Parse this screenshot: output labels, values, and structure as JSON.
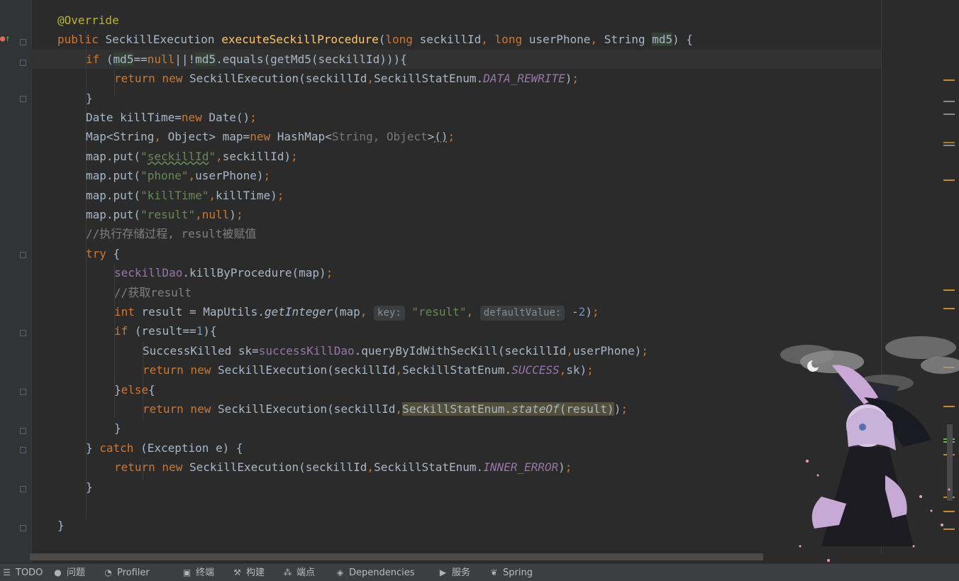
{
  "editor": {
    "lines": [
      {
        "tokens": [
          {
            "c": "ann",
            "t": "@Override"
          }
        ]
      },
      {
        "tokens": [
          {
            "c": "kw",
            "t": "public "
          },
          {
            "c": "",
            "t": "SeckillExecution "
          },
          {
            "c": "fn",
            "t": "executeSeckillProcedure"
          },
          {
            "c": "",
            "t": "("
          },
          {
            "c": "kw",
            "t": "long "
          },
          {
            "c": "",
            "t": "seckillId"
          },
          {
            "c": "kw",
            "t": ", long "
          },
          {
            "c": "",
            "t": "userPhone"
          },
          {
            "c": "kw",
            "t": ", "
          },
          {
            "c": "",
            "t": "String "
          },
          {
            "c": "p-md5",
            "t": "md5"
          },
          {
            "c": "",
            "t": ") {"
          }
        ]
      },
      {
        "tokens": [
          {
            "c": "kw",
            "t": "if "
          },
          {
            "c": "",
            "t": "("
          },
          {
            "c": "p-md5",
            "t": "md5"
          },
          {
            "c": "",
            "t": "=="
          },
          {
            "c": "kw",
            "t": "null"
          },
          {
            "c": "",
            "t": "||!"
          },
          {
            "c": "caret",
            "t": ""
          },
          {
            "c": "p-md5",
            "t": "md5"
          },
          {
            "c": "",
            "t": ".equals(getMd5(seckillId))){"
          }
        ]
      },
      {
        "tokens": [
          {
            "c": "kw",
            "t": "return new "
          },
          {
            "c": "",
            "t": "SeckillExecution(seckillId"
          },
          {
            "c": "kw",
            "t": ","
          },
          {
            "c": "",
            "t": "SeckillStatEnum."
          },
          {
            "c": "cst",
            "t": "DATA_REWRITE"
          },
          {
            "c": "",
            "t": ")"
          },
          {
            "c": "kw",
            "t": ";"
          }
        ]
      },
      {
        "tokens": [
          {
            "c": "",
            "t": "}"
          }
        ]
      },
      {
        "tokens": [
          {
            "c": "",
            "t": "Date killTime="
          },
          {
            "c": "kw",
            "t": "new "
          },
          {
            "c": "",
            "t": "Date()"
          },
          {
            "c": "kw",
            "t": ";"
          }
        ]
      },
      {
        "tokens": [
          {
            "c": "",
            "t": "Map<String"
          },
          {
            "c": "kw",
            "t": ", "
          },
          {
            "c": "",
            "t": "Object> map="
          },
          {
            "c": "kw",
            "t": "new "
          },
          {
            "c": "",
            "t": "HashMap<"
          },
          {
            "c": "gr",
            "t": "String, Object"
          },
          {
            "c": "",
            "t": ">"
          },
          {
            "c": "dotu",
            "t": "()"
          },
          {
            "c": "kw",
            "t": ";"
          }
        ]
      },
      {
        "tokens": [
          {
            "c": "",
            "t": "map.put("
          },
          {
            "c": "str",
            "t": "\""
          },
          {
            "c": "str uline",
            "t": "seckillId"
          },
          {
            "c": "str",
            "t": "\""
          },
          {
            "c": "kw",
            "t": ","
          },
          {
            "c": "",
            "t": "seckillId)"
          },
          {
            "c": "kw",
            "t": ";"
          }
        ]
      },
      {
        "tokens": [
          {
            "c": "",
            "t": "map.put("
          },
          {
            "c": "str",
            "t": "\"phone\""
          },
          {
            "c": "kw",
            "t": ","
          },
          {
            "c": "",
            "t": "userPhone)"
          },
          {
            "c": "kw",
            "t": ";"
          }
        ]
      },
      {
        "tokens": [
          {
            "c": "",
            "t": "map.put("
          },
          {
            "c": "str",
            "t": "\"killTime\""
          },
          {
            "c": "kw",
            "t": ","
          },
          {
            "c": "",
            "t": "killTime)"
          },
          {
            "c": "kw",
            "t": ";"
          }
        ]
      },
      {
        "tokens": [
          {
            "c": "",
            "t": "map.put("
          },
          {
            "c": "str",
            "t": "\"result\""
          },
          {
            "c": "kw",
            "t": ",null"
          },
          {
            "c": "",
            "t": ")"
          },
          {
            "c": "kw",
            "t": ";"
          }
        ]
      },
      {
        "tokens": [
          {
            "c": "cmt",
            "t": "//执行存储过程, result被赋值"
          }
        ]
      },
      {
        "tokens": [
          {
            "c": "kw",
            "t": "try "
          },
          {
            "c": "",
            "t": "{"
          }
        ]
      },
      {
        "tokens": [
          {
            "c": "fld",
            "t": "seckillDao"
          },
          {
            "c": "",
            "t": ".killByProcedure(map)"
          },
          {
            "c": "kw",
            "t": ";"
          }
        ]
      },
      {
        "tokens": [
          {
            "c": "cmt",
            "t": "//获取result"
          }
        ]
      },
      {
        "tokens": [
          {
            "c": "kw",
            "t": "int "
          },
          {
            "c": "",
            "t": "result = MapUtils."
          },
          {
            "c": "st",
            "t": "getInteger"
          },
          {
            "c": "",
            "t": "(map"
          },
          {
            "c": "kw",
            "t": ", "
          },
          {
            "c": "hint",
            "t": "key:"
          },
          {
            "c": "str",
            "t": " \"result\""
          },
          {
            "c": "kw",
            "t": ", "
          },
          {
            "c": "hint",
            "t": "defaultValue:"
          },
          {
            "c": "",
            "t": " -"
          },
          {
            "c": "num",
            "t": "2"
          },
          {
            "c": "",
            "t": ")"
          },
          {
            "c": "kw",
            "t": ";"
          }
        ]
      },
      {
        "tokens": [
          {
            "c": "kw",
            "t": "if "
          },
          {
            "c": "",
            "t": "(result=="
          },
          {
            "c": "num",
            "t": "1"
          },
          {
            "c": "",
            "t": "){"
          }
        ]
      },
      {
        "tokens": [
          {
            "c": "",
            "t": "SuccessKilled sk="
          },
          {
            "c": "fld",
            "t": "successKillDao"
          },
          {
            "c": "",
            "t": ".queryByIdWithSecKill(seckillId"
          },
          {
            "c": "kw",
            "t": ","
          },
          {
            "c": "",
            "t": "userPhone)"
          },
          {
            "c": "kw",
            "t": ";"
          }
        ]
      },
      {
        "tokens": [
          {
            "c": "kw",
            "t": "return new "
          },
          {
            "c": "",
            "t": "SeckillExecution(seckillId"
          },
          {
            "c": "kw",
            "t": ","
          },
          {
            "c": "",
            "t": "SeckillStatEnum."
          },
          {
            "c": "cst",
            "t": "SUCCESS"
          },
          {
            "c": "kw",
            "t": ","
          },
          {
            "c": "",
            "t": "sk)"
          },
          {
            "c": "kw",
            "t": ";"
          }
        ]
      },
      {
        "tokens": [
          {
            "c": "",
            "t": "}"
          },
          {
            "c": "kw",
            "t": "else"
          },
          {
            "c": "",
            "t": "{"
          }
        ]
      },
      {
        "tokens": [
          {
            "c": "kw",
            "t": "return new "
          },
          {
            "c": "",
            "t": "SeckillExecution(seckillId"
          },
          {
            "c": "kw",
            "t": ","
          },
          {
            "c": "sel",
            "t": "SeckillStatEnum."
          },
          {
            "c": "sel st",
            "t": "stateOf"
          },
          {
            "c": "sel",
            "t": "(result)"
          },
          {
            "c": "",
            "t": ")"
          },
          {
            "c": "kw",
            "t": ";"
          }
        ]
      },
      {
        "tokens": [
          {
            "c": "",
            "t": "}"
          }
        ]
      },
      {
        "tokens": [
          {
            "c": "",
            "t": "} "
          },
          {
            "c": "kw",
            "t": "catch "
          },
          {
            "c": "",
            "t": "(Exception e) {"
          }
        ]
      },
      {
        "tokens": [
          {
            "c": "kw",
            "t": "return new "
          },
          {
            "c": "",
            "t": "SeckillExecution(seckillId"
          },
          {
            "c": "kw",
            "t": ","
          },
          {
            "c": "",
            "t": "SeckillStatEnum."
          },
          {
            "c": "cst",
            "t": "INNER_ERROR"
          },
          {
            "c": "",
            "t": ")"
          },
          {
            "c": "kw",
            "t": ";"
          }
        ]
      },
      {
        "tokens": [
          {
            "c": "",
            "t": "}"
          }
        ]
      },
      {
        "tokens": []
      },
      {
        "tokens": [
          {
            "c": "",
            "t": "}"
          }
        ]
      }
    ]
  },
  "bottom_toolbar": [
    {
      "label": "TODO",
      "icon": "list-icon"
    },
    {
      "label": "问题",
      "icon": "problems-icon"
    },
    {
      "label": "Profiler",
      "icon": "profiler-icon"
    },
    {
      "label": "终端",
      "icon": "terminal-icon"
    },
    {
      "label": "构建",
      "icon": "build-hammer-icon"
    },
    {
      "label": "端点",
      "icon": "endpoints-icon"
    },
    {
      "label": "Dependencies",
      "icon": "dependencies-icon"
    },
    {
      "label": "服务",
      "icon": "services-play-icon"
    },
    {
      "label": "Spring",
      "icon": "spring-leaf-icon"
    }
  ],
  "colors": {
    "background": "#2b2b2b",
    "keyword": "#cc7832",
    "annotation": "#bbb529",
    "method": "#ffc66d",
    "string": "#6a8759",
    "number": "#6897bb",
    "comment": "#808080",
    "field": "#9876aa"
  }
}
